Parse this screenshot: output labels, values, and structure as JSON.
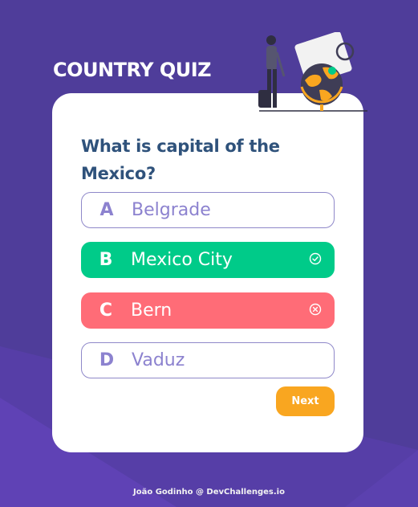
{
  "app": {
    "title": "COUNTRY QUIZ"
  },
  "quiz": {
    "question": "What is capital of the Mexico?",
    "options": [
      {
        "letter": "A",
        "text": "Belgrade",
        "state": "neutral"
      },
      {
        "letter": "B",
        "text": "Mexico City",
        "state": "correct",
        "icon": "check-circle-icon"
      },
      {
        "letter": "C",
        "text": "Bern",
        "state": "wrong",
        "icon": "x-circle-icon"
      },
      {
        "letter": "D",
        "text": "Vaduz",
        "state": "neutral"
      }
    ],
    "next_label": "Next"
  },
  "footer": {
    "credit": "João Godinho @ DevChallenges.io"
  },
  "colors": {
    "background": "#4f3d9a",
    "title": "#ffffff",
    "question": "#2f527b",
    "neutral_border": "#8f88c9",
    "neutral_text": "#8c82cf",
    "correct": "#00cb89",
    "wrong": "#ff6c77",
    "next_button": "#f9a620"
  }
}
